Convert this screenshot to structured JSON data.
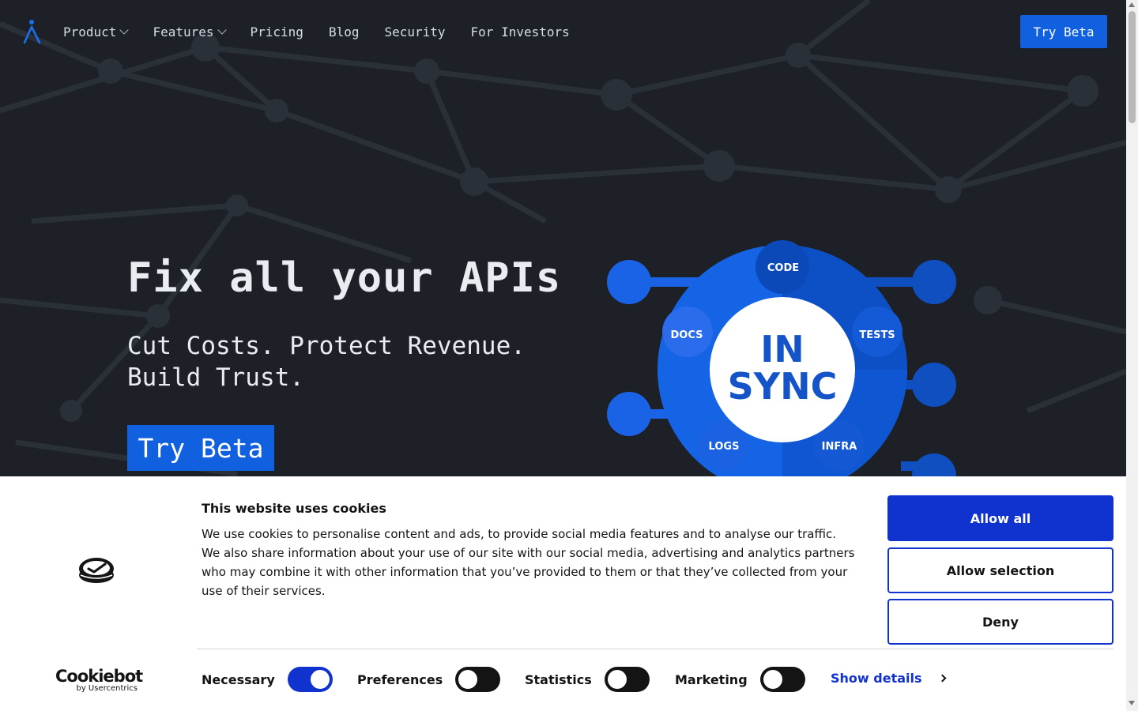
{
  "nav": {
    "items": [
      {
        "label": "Product",
        "has_dropdown": true
      },
      {
        "label": "Features",
        "has_dropdown": true
      },
      {
        "label": "Pricing",
        "has_dropdown": false
      },
      {
        "label": "Blog",
        "has_dropdown": false
      },
      {
        "label": "Security",
        "has_dropdown": false
      },
      {
        "label": "For Investors",
        "has_dropdown": false
      }
    ],
    "cta_label": "Try Beta"
  },
  "hero": {
    "title": "Fix all your APIs",
    "subtitle": "Cut Costs. Protect Revenue. Build Trust.",
    "cta_label": "Try Beta"
  },
  "diagram": {
    "center_lines": [
      "IN",
      "SYNC"
    ],
    "segments": [
      "CODE",
      "TESTS",
      "INFRA",
      "LOGS",
      "DOCS"
    ]
  },
  "cookie": {
    "title": "This website uses cookies",
    "body": "We use cookies to personalise content and ads, to provide social media features and to analyse our traffic. We also share information about your use of our site with our social media, advertising and analytics partners who may combine it with other information that you’ve provided to them or that they’ve collected from your use of their services.",
    "buttons": {
      "allow_all": "Allow all",
      "allow_selection": "Allow selection",
      "deny": "Deny"
    },
    "toggles": [
      {
        "label": "Necessary",
        "on": true
      },
      {
        "label": "Preferences",
        "on": false
      },
      {
        "label": "Statistics",
        "on": false
      },
      {
        "label": "Marketing",
        "on": false
      }
    ],
    "show_details": "Show details",
    "brand_main": "Cookiebot",
    "brand_by": "by Usercentrics"
  },
  "colors": {
    "accent": "#1060e0",
    "cookie_accent": "#1032cf",
    "hero_bg": "#1d2127"
  }
}
